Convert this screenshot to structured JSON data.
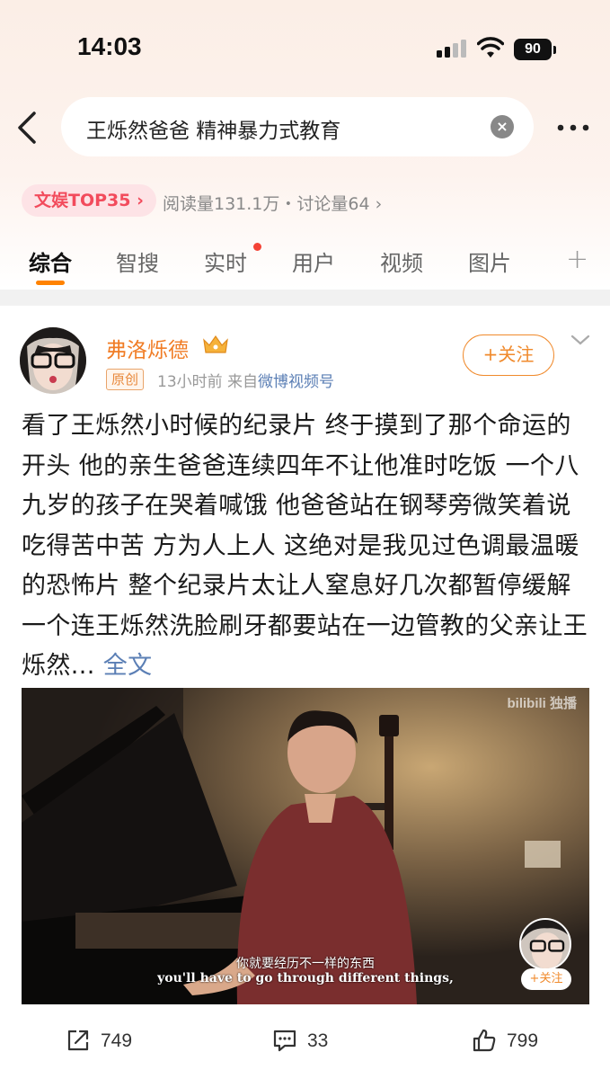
{
  "status_bar": {
    "time": "14:03",
    "battery": "90"
  },
  "search": {
    "query": "王烁然爸爸 精神暴力式教育"
  },
  "topic": {
    "badge": "文娱TOP35",
    "stats": "阅读量131.1万・讨论量64"
  },
  "tabs": [
    {
      "label": "综合"
    },
    {
      "label": "智搜"
    },
    {
      "label": "实时"
    },
    {
      "label": "用户"
    },
    {
      "label": "视频"
    },
    {
      "label": "图片"
    }
  ],
  "post": {
    "author": "弗洛烁德",
    "original_badge": "原创",
    "time": "13小时前",
    "source_prefix": "来自",
    "source": "微博视频号",
    "follow_label": "+关注",
    "text": "看了王烁然小时候的纪录片 终于摸到了那个命运的开头 他的亲生爸爸连续四年不让他准时吃饭 一个八九岁的孩子在哭着喊饿 他爸爸站在钢琴旁微笑着说 吃得苦中苦 方为人上人 这绝对是我见过色调最温暖的恐怖片 整个纪录片太让人窒息好几次都暂停缓解 一个连王烁然洗脸刷牙都要站在一边管教的父亲让王烁然...",
    "full_text_label": "全文",
    "video": {
      "watermark": "bilibili 独播",
      "subtitle_zh": "你就要经历不一样的东西",
      "subtitle_en": "you'll have to go through different things,",
      "follow_label": "+关注"
    },
    "actions": {
      "shares": "749",
      "comments": "33",
      "likes": "799"
    }
  },
  "colors": {
    "accent": "#ff8200",
    "author": "#f07c25",
    "link": "#5b7fb5",
    "topic": "#f24b5c"
  }
}
